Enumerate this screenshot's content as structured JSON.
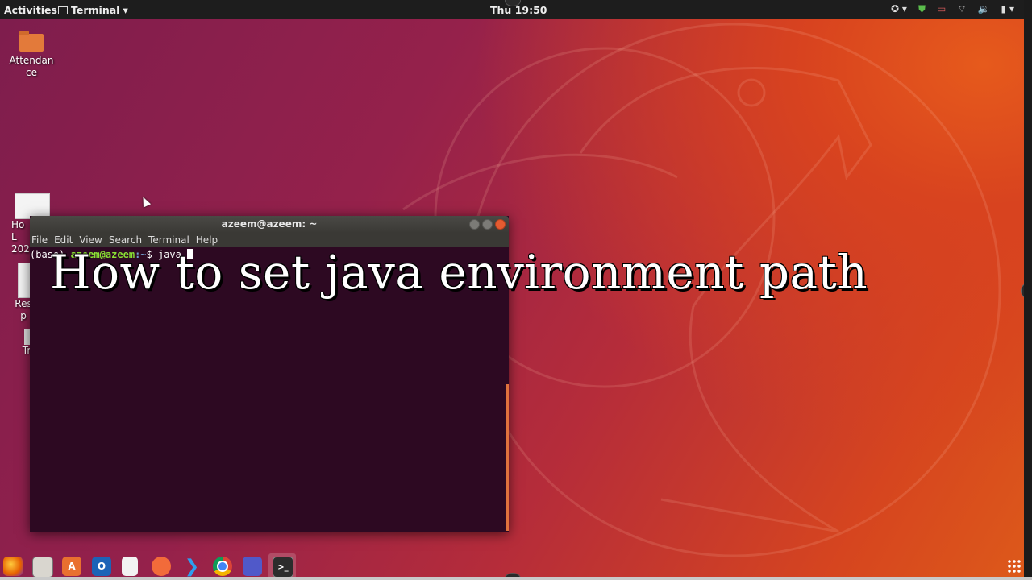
{
  "topbar": {
    "activities": "Activities",
    "app_menu": "Terminal",
    "app_menu_arrow": "▾",
    "clock": "Thu 19:50",
    "tray": {
      "accessibility": "✪ ▾",
      "shield": "⛊",
      "camera": "▭",
      "wifi": "⌔",
      "volume": "🔉",
      "battery": "▮ ▾"
    }
  },
  "desktop": {
    "icons": [
      {
        "label": "Attendan\nce",
        "icon": "folder-icon"
      },
      {
        "label": "Ho\nL\n202",
        "icon": "document-icon"
      },
      {
        "label": "Res\np",
        "icon": "document-icon"
      },
      {
        "label": "Tr",
        "icon": "trash-icon"
      }
    ]
  },
  "terminal": {
    "title": "azeem@azeem: ~",
    "menu": [
      "File",
      "Edit",
      "View",
      "Search",
      "Terminal",
      "Help"
    ],
    "prompt_prefix": "(base) ",
    "prompt_user": "azeem@azeem",
    "prompt_path": ":~",
    "prompt_symbol": "$ ",
    "command": "java "
  },
  "caption": "How to set java environment path",
  "dock": {
    "apps": [
      "firefox-icon",
      "files-icon",
      "software-center-icon",
      "outlook-icon",
      "document-viewer-icon",
      "postman-icon",
      "vscode-icon",
      "chrome-icon",
      "teams-icon",
      "terminal-icon"
    ],
    "labels": {
      "software": "A",
      "outlook": "O",
      "terminal": ">_"
    },
    "show_apps": "show-applications-icon"
  },
  "colors": {
    "prompt_user": "#8ae234",
    "prompt_path": "#729fcf",
    "terminal_bg": "#2d0922",
    "accent": "#e95420"
  }
}
